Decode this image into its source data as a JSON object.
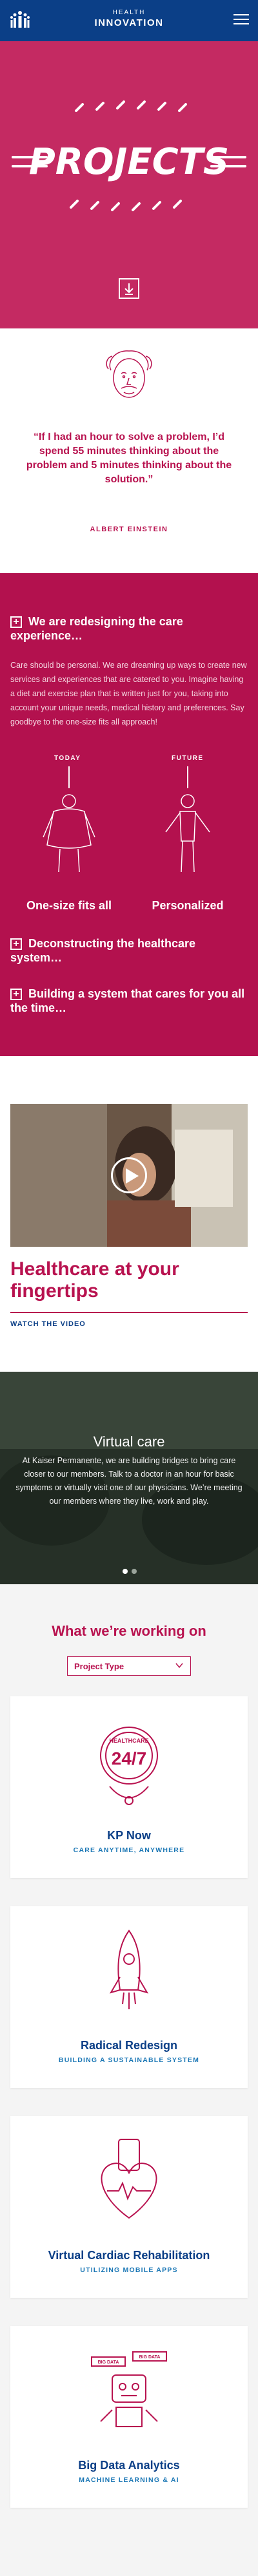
{
  "header": {
    "brand_small": "HEALTH",
    "brand_big": "INNOVATION",
    "menu_icon": "hamburger-icon",
    "logo_icon": "people-logo-icon"
  },
  "hero": {
    "title": "PROJECTS",
    "scroll_icon": "arrow-down-icon"
  },
  "quote": {
    "text": "“If I had an hour to solve a problem, I’d spend 55 minutes thinking about the problem and 5 minutes thinking about the solution.”",
    "author": "ALBERT EINSTEIN"
  },
  "care": {
    "heading1": "We are redesigning the care experience…",
    "body": "Care should be personal. We are dreaming up ways to create new services and experiences that are catered to you. Imagine having a diet and exercise plan that is written just for you, taking into account your unique needs, medical history and preferences. Say goodbye to the one-size fits all approach!",
    "today_label": "TODAY",
    "future_label": "FUTURE",
    "today_caption": "One-size fits all",
    "future_caption": "Personalized",
    "heading2": "Deconstructing the healthcare system…",
    "heading3": "Building a system that cares for you all the time…",
    "plus_symbol": "+"
  },
  "video": {
    "title": "Healthcare at your fingertips",
    "link": "WATCH THE VIDEO"
  },
  "virtual": {
    "title": "Virtual care",
    "body": "At Kaiser Permanente, we are building bridges to bring care closer to our members. Talk to a doctor in an hour for basic symptoms or virtually visit one of our physicians. We’re meeting our members where they live, work and play."
  },
  "working": {
    "title": "What we’re working on",
    "filter_label": "Project Type",
    "cards": [
      {
        "title": "KP Now",
        "subtitle": "CARE ANYTIME, ANYWHERE",
        "badge_top": "HEALTHCARE",
        "badge_num": "24/7"
      },
      {
        "title": "Radical Redesign",
        "subtitle": "BUILDING A SUSTAINABLE SYSTEM"
      },
      {
        "title": "Virtual Cardiac Rehabilitation",
        "subtitle": "UTILIZING MOBILE APPS"
      },
      {
        "title": "Big Data Analytics",
        "subtitle": "MACHINE LEARNING & AI",
        "tag_left": "BIG DATA",
        "tag_right": "BIG DATA"
      }
    ]
  },
  "colors": {
    "navy": "#0b3f87",
    "hero_pink": "#c42a62",
    "magenta": "#b3114e",
    "accent": "#b8124f",
    "sub_blue": "#1b77b5"
  }
}
